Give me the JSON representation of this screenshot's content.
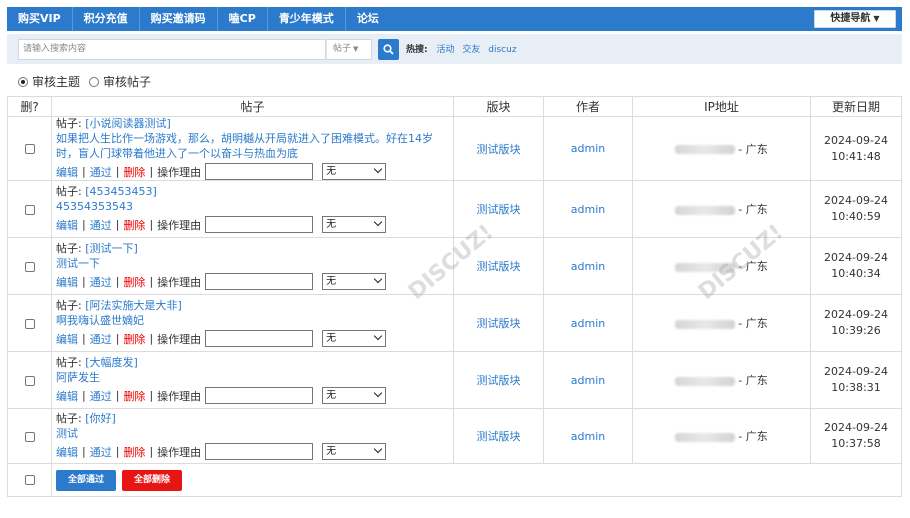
{
  "topnav": {
    "items": [
      "购买VIP",
      "积分充值",
      "购买邀请码",
      "嗑CP",
      "青少年模式",
      "论坛"
    ],
    "quick_nav": "快捷导航"
  },
  "search": {
    "placeholder": "请输入搜索内容",
    "type": "帖子",
    "hot_label": "热搜:",
    "hot_words": [
      "活动",
      "交友",
      "discuz"
    ]
  },
  "review_mode": {
    "options": [
      "审核主题",
      "审核帖子"
    ],
    "selected": "审核主题"
  },
  "table": {
    "headers": [
      "删?",
      "帖子",
      "版块",
      "作者",
      "IP地址",
      "更新日期"
    ],
    "op_labels": {
      "edit": "编辑",
      "pass": "通过",
      "delete": "删除",
      "reason": "操作理由",
      "select_default": "无"
    },
    "rows": [
      {
        "title_prefix": "帖子: ",
        "title": "[小说阅读器测试]",
        "body": "如果把人生比作一场游戏，那么，胡明樾从开局就进入了困难模式。好在14岁时，盲人门球带着他进入了一个以奋斗与热血为底",
        "board": "测试版块",
        "author": "admin",
        "ip_suffix": "- 广东",
        "date": "2024-09-24",
        "time": "10:41:48"
      },
      {
        "title_prefix": "帖子: ",
        "title": "[453453453]",
        "body": "45354353543",
        "board": "测试版块",
        "author": "admin",
        "ip_suffix": "- 广东",
        "date": "2024-09-24",
        "time": "10:40:59"
      },
      {
        "title_prefix": "帖子: ",
        "title": "[测试一下]",
        "body": "测试一下",
        "board": "测试版块",
        "author": "admin",
        "ip_suffix": "- 广东",
        "date": "2024-09-24",
        "time": "10:40:34"
      },
      {
        "title_prefix": "帖子: ",
        "title": "[阿法实施大是大非]",
        "body": "啊我嗨认盛世嫡妃",
        "board": "测试版块",
        "author": "admin",
        "ip_suffix": "- 广东",
        "date": "2024-09-24",
        "time": "10:39:26"
      },
      {
        "title_prefix": "帖子: ",
        "title": "[大幅度发]",
        "body": "阿萨发生",
        "board": "测试版块",
        "author": "admin",
        "ip_suffix": "- 广东",
        "date": "2024-09-24",
        "time": "10:38:31"
      },
      {
        "title_prefix": "帖子: ",
        "title": "[你好]",
        "body": "测试",
        "board": "测试版块",
        "author": "admin",
        "ip_suffix": "- 广东",
        "date": "2024-09-24",
        "time": "10:37:58"
      }
    ]
  },
  "footer": {
    "pass_all": "全部通过",
    "delete_all": "全部删除"
  },
  "colors": {
    "primary": "#2b7acb",
    "danger": "#e81515",
    "search_bg": "#e8eef6"
  }
}
